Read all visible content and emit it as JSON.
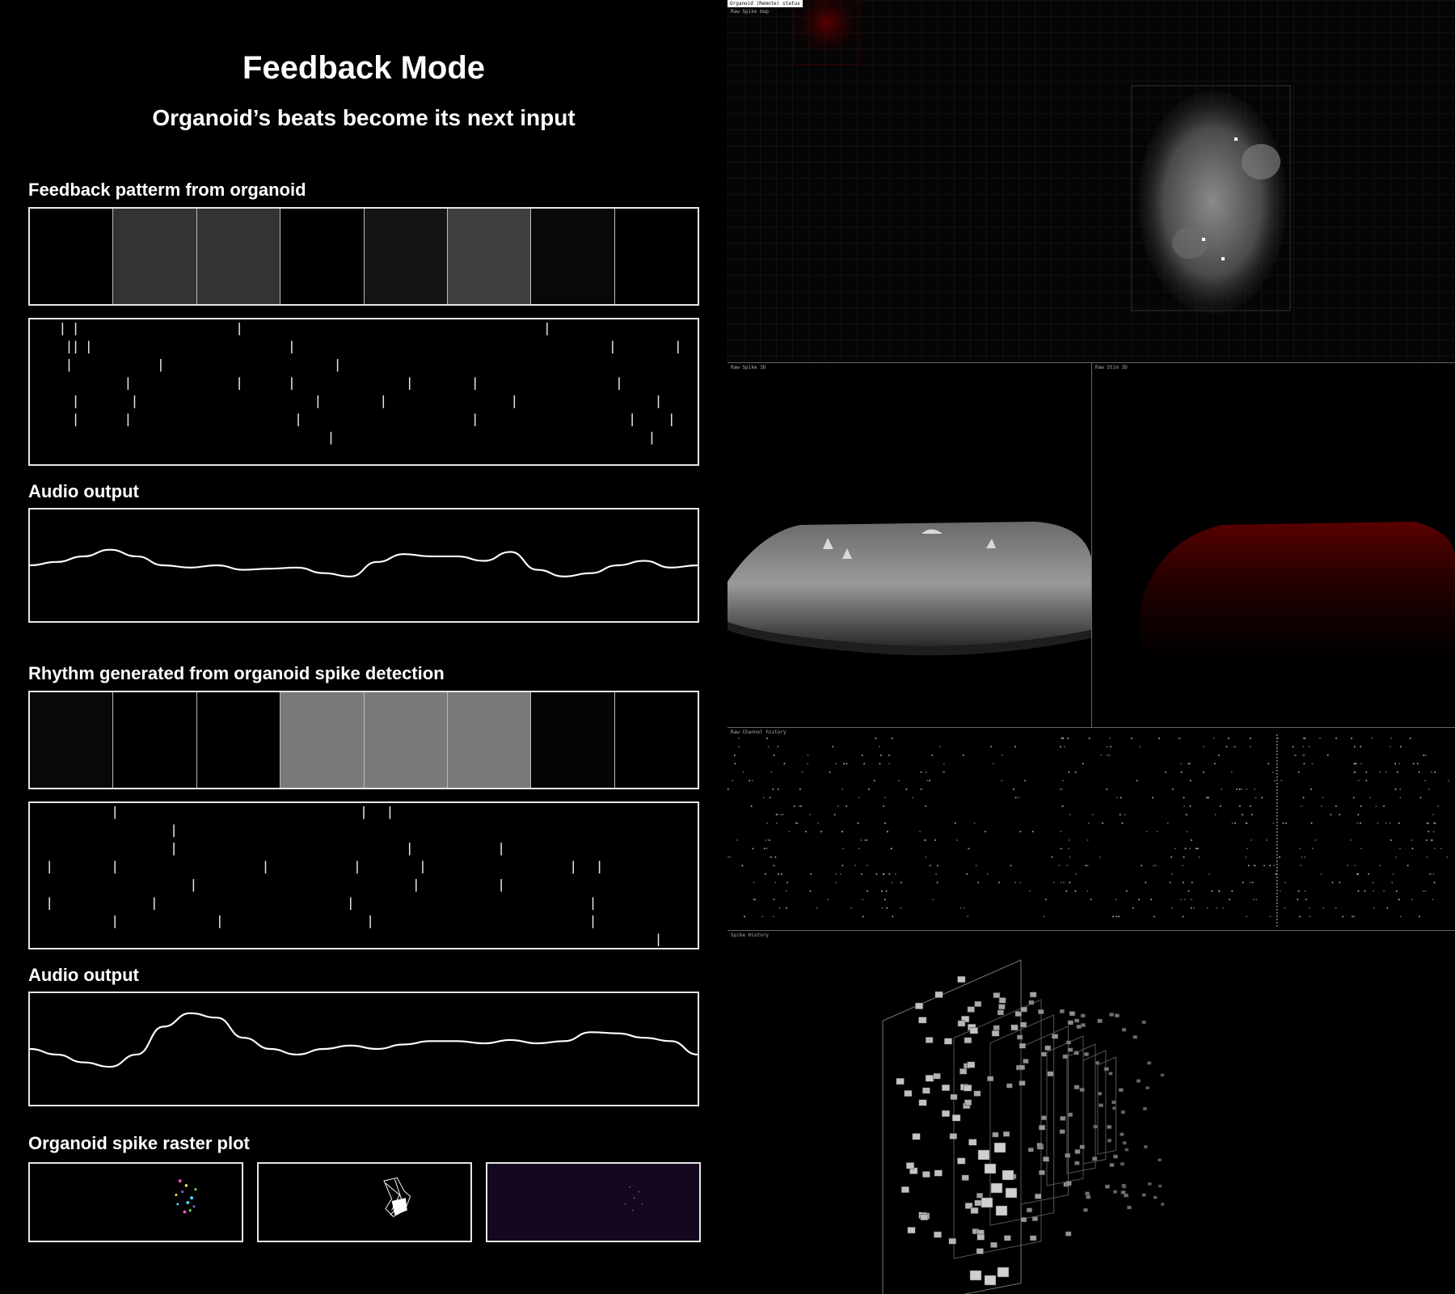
{
  "header": {
    "title": "Feedback Mode",
    "subtitle": "Organoid’s beats become its next input"
  },
  "feedback": {
    "label": "Feedback patterm from organoid",
    "steps": [
      0.0,
      0.2,
      0.2,
      0.0,
      0.08,
      0.25,
      0.03,
      0.0
    ],
    "raster": [
      [
        4,
        0
      ],
      [
        5,
        1
      ],
      [
        5,
        2
      ],
      [
        6,
        0
      ],
      [
        6,
        1
      ],
      [
        6,
        4
      ],
      [
        6,
        5
      ],
      [
        8,
        1
      ],
      [
        14,
        3
      ],
      [
        14,
        5
      ],
      [
        19,
        2
      ],
      [
        15,
        4
      ],
      [
        31,
        0
      ],
      [
        31,
        3
      ],
      [
        39,
        1
      ],
      [
        39,
        3
      ],
      [
        40,
        5
      ],
      [
        43,
        4
      ],
      [
        45,
        6
      ],
      [
        46,
        2
      ],
      [
        53,
        4
      ],
      [
        57,
        3
      ],
      [
        67,
        3
      ],
      [
        67,
        5
      ],
      [
        73,
        4
      ],
      [
        78,
        0
      ],
      [
        88,
        1
      ],
      [
        89,
        3
      ],
      [
        91,
        5
      ],
      [
        94,
        6
      ],
      [
        95,
        4
      ],
      [
        97,
        5
      ],
      [
        98,
        1
      ]
    ],
    "audio_label": "Audio output",
    "audio": [
      0.5,
      0.47,
      0.42,
      0.36,
      0.42,
      0.5,
      0.52,
      0.5,
      0.54,
      0.53,
      0.52,
      0.57,
      0.6,
      0.47,
      0.4,
      0.42,
      0.42,
      0.46,
      0.38,
      0.54,
      0.6,
      0.57,
      0.5,
      0.46,
      0.52,
      0.5
    ]
  },
  "rhythm": {
    "label": "Rhythm generated from organoid spike detection",
    "steps": [
      0.03,
      0.0,
      0.0,
      0.48,
      0.48,
      0.48,
      0.02,
      0.0
    ],
    "raster": [
      [
        2,
        3
      ],
      [
        2,
        5
      ],
      [
        12,
        0
      ],
      [
        12,
        3
      ],
      [
        12,
        6
      ],
      [
        18,
        5
      ],
      [
        21,
        1
      ],
      [
        21,
        2
      ],
      [
        24,
        4
      ],
      [
        28,
        6
      ],
      [
        35,
        3
      ],
      [
        48,
        5
      ],
      [
        50,
        0
      ],
      [
        49,
        3
      ],
      [
        51,
        6
      ],
      [
        54,
        0
      ],
      [
        57,
        2
      ],
      [
        58,
        4
      ],
      [
        59,
        3
      ],
      [
        71,
        2
      ],
      [
        71,
        4
      ],
      [
        82,
        3
      ],
      [
        85,
        5
      ],
      [
        85,
        6
      ],
      [
        86,
        3
      ],
      [
        95,
        7
      ]
    ],
    "audio_label": "Audio output",
    "audio": [
      0.5,
      0.55,
      0.62,
      0.66,
      0.55,
      0.3,
      0.18,
      0.22,
      0.4,
      0.5,
      0.55,
      0.5,
      0.47,
      0.5,
      0.46,
      0.43,
      0.43,
      0.45,
      0.42,
      0.45,
      0.43,
      0.35,
      0.36,
      0.4,
      0.43,
      0.55
    ]
  },
  "raster_plot": {
    "label": "Organoid spike raster plot"
  },
  "monitor": {
    "status_tag": "Organoid (Remote) status",
    "spike_map_label": "Raw Spike map",
    "spike_3d_label": "Raw Spike 3D",
    "stim_3d_label": "Raw Stim 3D",
    "channel_history_label": "Raw Channel history",
    "spike_history_label": "Spike History"
  },
  "colors": {
    "background": "#000000",
    "border": "#e6e6e6",
    "stim_red": "#5a0000",
    "purple_panel": "#140820"
  }
}
